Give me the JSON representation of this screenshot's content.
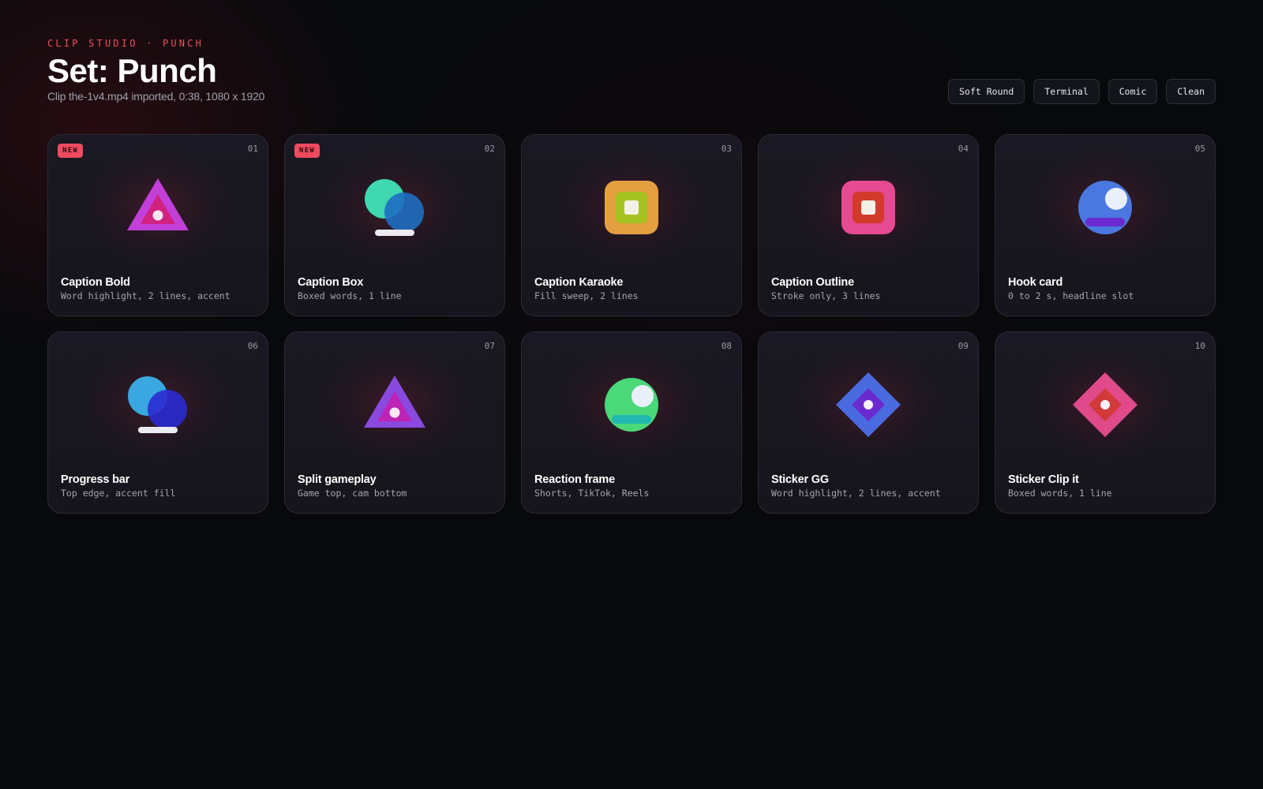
{
  "header": {
    "eyebrow": "CLIP STUDIO · PUNCH",
    "title": "Set: Punch",
    "subtitle": "Clip the-1v4.mp4 imported, 0:38, 1080 x 1920"
  },
  "chips": [
    "Soft Round",
    "Terminal",
    "Comic",
    "Clean"
  ],
  "cards": [
    {
      "num": "01",
      "badge": "NEW",
      "title": "Caption Bold",
      "desc": "Word highlight, 2 lines, accent",
      "icon": "triangle-icon",
      "colors": [
        "#c23fd8",
        "#d21f74"
      ]
    },
    {
      "num": "02",
      "badge": "NEW",
      "title": "Caption Box",
      "desc": "Boxed words, 1 line",
      "icon": "circles-icon",
      "colors": [
        "#3fd8b0",
        "#1f6ec2"
      ]
    },
    {
      "num": "03",
      "badge": "",
      "title": "Caption Karaoke",
      "desc": "Fill sweep, 2 lines",
      "icon": "rounded-square-icon",
      "colors": [
        "#e4a040",
        "#a6c220"
      ]
    },
    {
      "num": "04",
      "badge": "",
      "title": "Caption Outline",
      "desc": "Stroke only, 3 lines",
      "icon": "rounded-square-icon",
      "colors": [
        "#e64a92",
        "#d23a2a"
      ]
    },
    {
      "num": "05",
      "badge": "",
      "title": "Hook card",
      "desc": "0 to 2 s, headline slot",
      "icon": "avatar-circle-icon",
      "colors": [
        "#4a78e0",
        "#6a2ad0"
      ]
    },
    {
      "num": "06",
      "badge": "",
      "title": "Progress bar",
      "desc": "Top edge, accent fill",
      "icon": "circles-icon",
      "colors": [
        "#3aa8e0",
        "#2a2ad0"
      ]
    },
    {
      "num": "07",
      "badge": "",
      "title": "Split gameplay",
      "desc": "Game top, cam bottom",
      "icon": "triangle-icon",
      "colors": [
        "#8a4ae0",
        "#c21fb0"
      ]
    },
    {
      "num": "08",
      "badge": "",
      "title": "Reaction frame",
      "desc": "Shorts, TikTok, Reels",
      "icon": "avatar-circle-icon",
      "colors": [
        "#4ad878",
        "#20b8b0"
      ]
    },
    {
      "num": "09",
      "badge": "",
      "title": "Sticker GG",
      "desc": "Word highlight, 2 lines, accent",
      "icon": "diamond-icon",
      "colors": [
        "#4a6ae0",
        "#6a2ad0"
      ]
    },
    {
      "num": "10",
      "badge": "",
      "title": "Sticker Clip it",
      "desc": "Boxed words, 1 line",
      "icon": "diamond-icon",
      "colors": [
        "#e04a8a",
        "#d23a3a"
      ]
    }
  ]
}
